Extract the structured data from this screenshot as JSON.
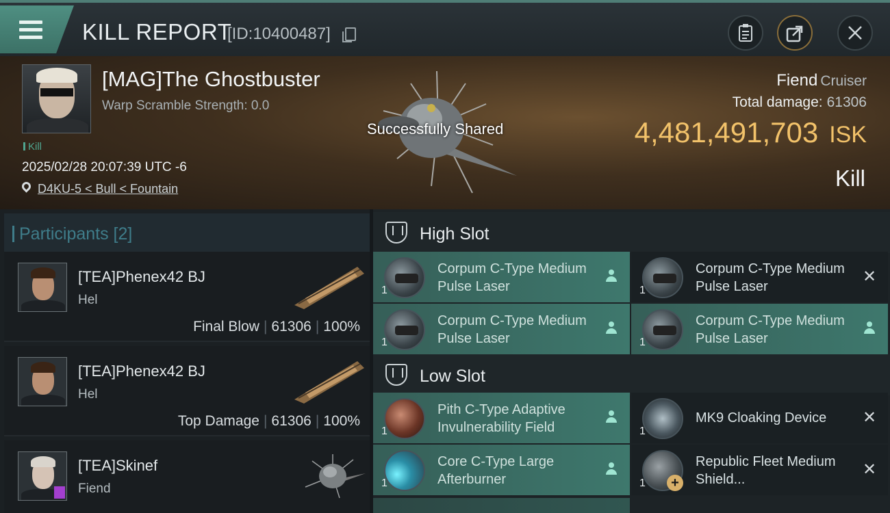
{
  "header": {
    "title": "KILL REPORT",
    "kill_id": "[ID:10400487]"
  },
  "victim": {
    "name": "[MAG]The Ghostbuster",
    "warp_scramble": "Warp Scramble Strength: 0.0",
    "badge": "Kill",
    "datetime": "2025/02/28 20:07:39 UTC -6",
    "location": "D4KU-5 < Bull < Fountain",
    "shared_toast": "Successfully Shared",
    "ship_name": "Fiend",
    "ship_class": "Cruiser",
    "total_damage_label": "Total damage:",
    "total_damage_value": "61306",
    "isk_value": "4,481,491,703",
    "isk_unit": "ISK",
    "result": "Kill"
  },
  "participants": {
    "header": "Participants [2]",
    "rows": [
      {
        "name": "[TEA]Phenex42 BJ",
        "ship": "Hel",
        "role": "Final Blow",
        "damage": "61306",
        "percent": "100%"
      },
      {
        "name": "[TEA]Phenex42 BJ",
        "ship": "Hel",
        "role": "Top Damage",
        "damage": "61306",
        "percent": "100%"
      },
      {
        "name": "[TEA]Skinef",
        "ship": "Fiend"
      }
    ]
  },
  "slots": {
    "high_label": "High Slot",
    "low_label": "Low Slot",
    "high_items": [
      {
        "name": "Corpum C-Type Medium Pulse Laser",
        "qty": "1",
        "status": "dropped",
        "icon": "pulse-laser-icon"
      },
      {
        "name": "Corpum C-Type Medium Pulse Laser",
        "qty": "1",
        "status": "destroyed",
        "icon": "pulse-laser-icon"
      },
      {
        "name": "Corpum C-Type Medium Pulse Laser",
        "qty": "1",
        "status": "dropped",
        "icon": "pulse-laser-icon"
      },
      {
        "name": "Corpum C-Type Medium Pulse Laser",
        "qty": "1",
        "status": "dropped",
        "icon": "pulse-laser-icon"
      }
    ],
    "low_items": [
      {
        "name": "Pith C-Type Adaptive Invulnerability Field",
        "qty": "1",
        "status": "dropped",
        "icon": "shield-hardener-icon"
      },
      {
        "name": "MK9 Cloaking Device",
        "qty": "1",
        "status": "destroyed",
        "icon": "cloaking-device-icon"
      },
      {
        "name": "Core C-Type Large Afterburner",
        "qty": "1",
        "status": "dropped",
        "icon": "afterburner-icon"
      },
      {
        "name": "Republic Fleet Medium Shield...",
        "qty": "1",
        "status": "destroyed",
        "icon": "shield-extender-icon"
      }
    ]
  },
  "colors": {
    "accent": "#3e786d",
    "isk": "#f2c26a",
    "participants_header": "#3f7d8a"
  }
}
